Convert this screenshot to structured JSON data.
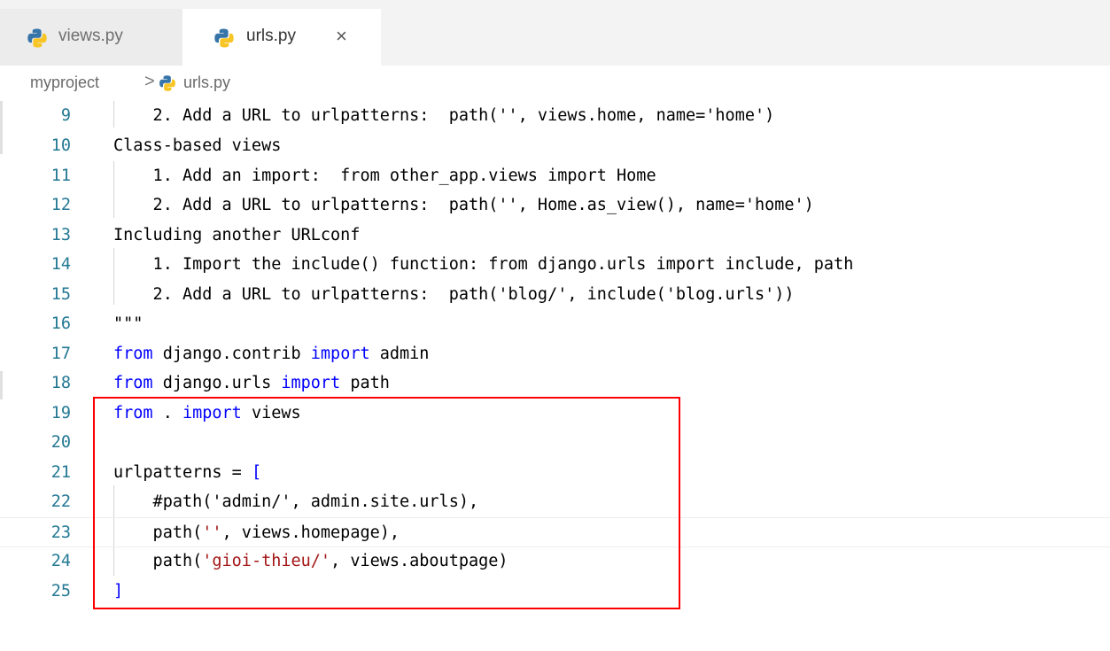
{
  "tabs": [
    {
      "label": "views.py",
      "active": false
    },
    {
      "label": "urls.py",
      "active": true,
      "close_glyph": "×"
    }
  ],
  "breadcrumb": {
    "folder": "myproject",
    "separator": ">",
    "file": "urls.py"
  },
  "colors": {
    "keyword": "#0000ff",
    "string": "#a31515",
    "comment": "#008000",
    "line_number": "#237893",
    "highlight_box": "#ff0000"
  },
  "icons": {
    "python_file": "python-file-icon",
    "close": "close-icon"
  },
  "lines": [
    {
      "n": "9",
      "t": "    2. Add a URL to urlpatterns:  path('', views.home, name='home')"
    },
    {
      "n": "10",
      "t": "Class-based views"
    },
    {
      "n": "11",
      "t": "    1. Add an import:  from other_app.views import Home"
    },
    {
      "n": "12",
      "t": "    2. Add a URL to urlpatterns:  path('', Home.as_view(), name='home')"
    },
    {
      "n": "13",
      "t": "Including another URLconf"
    },
    {
      "n": "14",
      "t": "    1. Import the include() function: from django.urls import include, path"
    },
    {
      "n": "15",
      "t": "    2. Add a URL to urlpatterns:  path('blog/', include('blog.urls'))"
    },
    {
      "n": "16",
      "t": "\"\"\""
    },
    {
      "n": "17",
      "k1": "from",
      "a": " django.contrib ",
      "k2": "import",
      "b": " admin"
    },
    {
      "n": "18",
      "k1": "from",
      "a": " django.urls ",
      "k2": "import",
      "b": " path"
    },
    {
      "n": "19",
      "k1": "from",
      "a": " . ",
      "k2": "import",
      "b": " views"
    },
    {
      "n": "20"
    },
    {
      "n": "21",
      "a": "urlpatterns = ",
      "k2": "["
    },
    {
      "n": "22",
      "c": "    #path('admin/', admin.site.urls),"
    },
    {
      "n": "23",
      "a": "    path(",
      "s": "''",
      "b": ", views.homepage),"
    },
    {
      "n": "24",
      "a": "    path(",
      "s": "'gioi-thieu/'",
      "b": ", views.aboutpage)"
    },
    {
      "n": "25",
      "k2": "]"
    }
  ]
}
